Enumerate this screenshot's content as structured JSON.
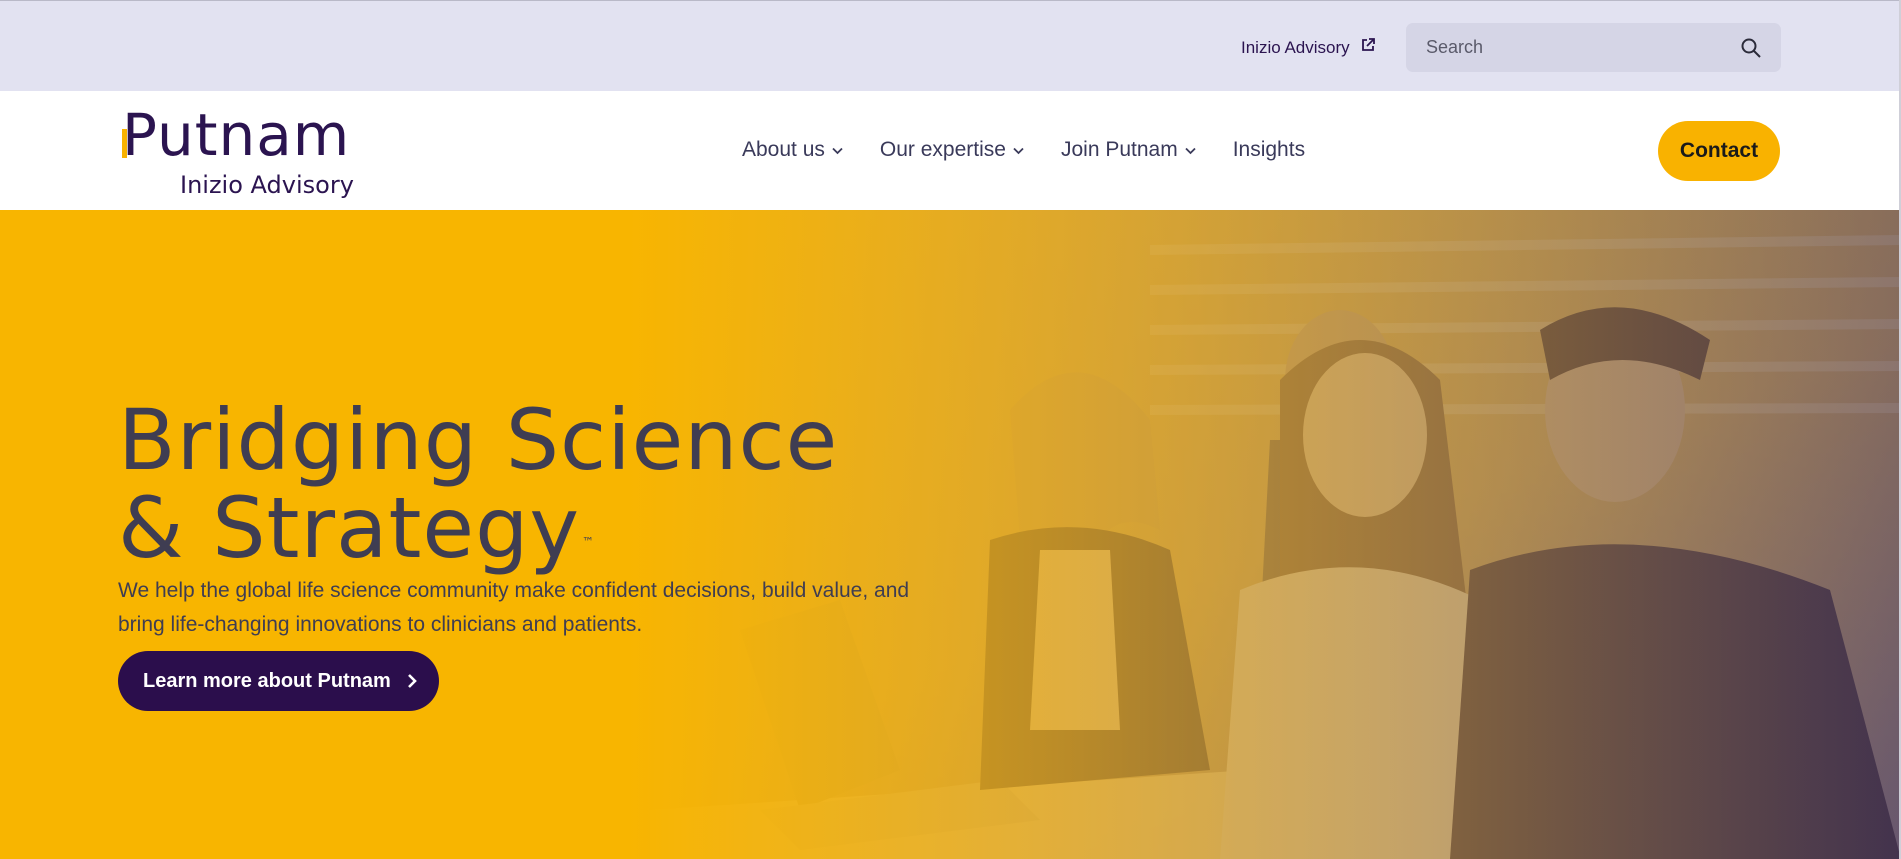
{
  "topbar": {
    "advisory_link": "Inizio Advisory",
    "search_placeholder": "Search"
  },
  "header": {
    "logo_main": "Putnam",
    "logo_sub": "Inizio Advisory",
    "nav": [
      {
        "label": "About us",
        "has_dropdown": true
      },
      {
        "label": "Our expertise",
        "has_dropdown": true
      },
      {
        "label": "Join Putnam",
        "has_dropdown": true
      },
      {
        "label": "Insights",
        "has_dropdown": false
      }
    ],
    "contact_label": "Contact"
  },
  "hero": {
    "title_line1": "Bridging Science",
    "title_line2": "& Strategy",
    "trademark": "™",
    "description": "We help the global life science community make confident decisions, build value, and bring life-changing innovations to clinicians and patients.",
    "cta_label": "Learn more about Putnam"
  },
  "colors": {
    "brand_purple": "#2b0e4c",
    "brand_yellow": "#f8b500",
    "topbar_bg": "#e2e2f1",
    "text_dark": "#3f3d52"
  },
  "icons": {
    "external_link": "external-link-icon",
    "search": "search-icon",
    "dropdown": "chevron-down-icon",
    "cta_arrow": "chevron-right-icon"
  }
}
